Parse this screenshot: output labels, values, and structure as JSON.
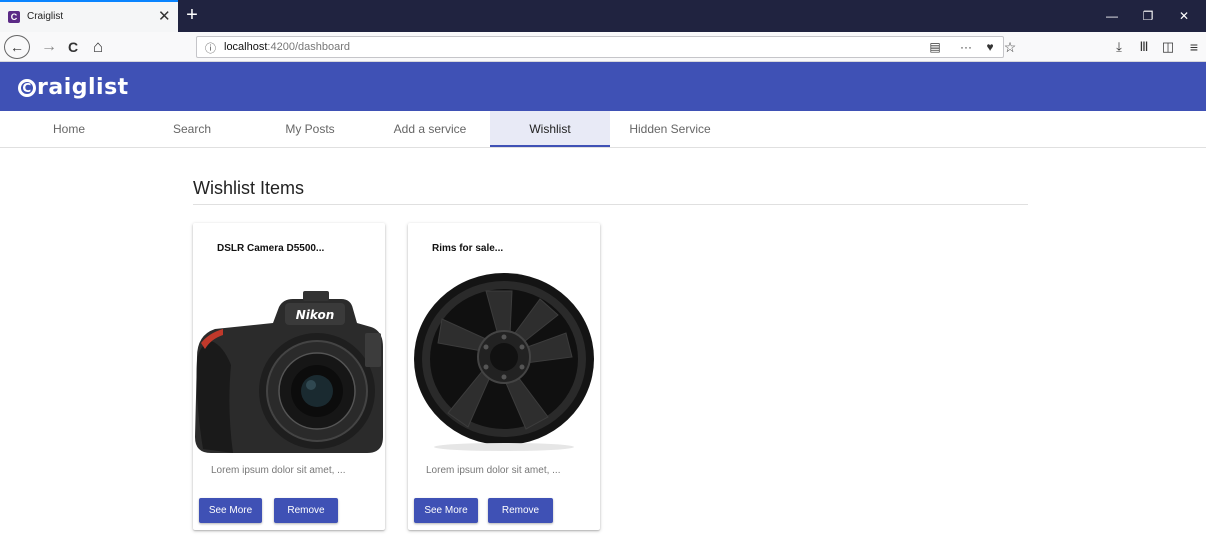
{
  "browser": {
    "tab_title": "Craiglist",
    "tab_close": "✕",
    "new_tab": "+",
    "favicon_letter": "C",
    "url_host": "localhost",
    "url_path": ":4200/dashboard",
    "back": "←",
    "forward": "→",
    "reload": "C",
    "home": "⌂"
  },
  "app": {
    "logo_letter": "C",
    "logo_rest": "raiglist",
    "brand_color": "#3f51b5"
  },
  "tabs": [
    {
      "label": "Home"
    },
    {
      "label": "Search"
    },
    {
      "label": "My Posts"
    },
    {
      "label": "Add a service"
    },
    {
      "label": "Wishlist",
      "active": true
    },
    {
      "label": "Hidden Service"
    }
  ],
  "wishlist": {
    "title": "Wishlist Items",
    "items": [
      {
        "title": "DSLR Camera D5500...",
        "image": "camera-image",
        "brand_text": "Nikon",
        "description": "Lorem ipsum dolor sit amet, ...",
        "see_more": "See More",
        "remove": "Remove"
      },
      {
        "title": "Rims for sale...",
        "image": "rim-image",
        "description": "Lorem ipsum dolor sit amet, ...",
        "see_more": "See More",
        "remove": "Remove"
      }
    ]
  }
}
